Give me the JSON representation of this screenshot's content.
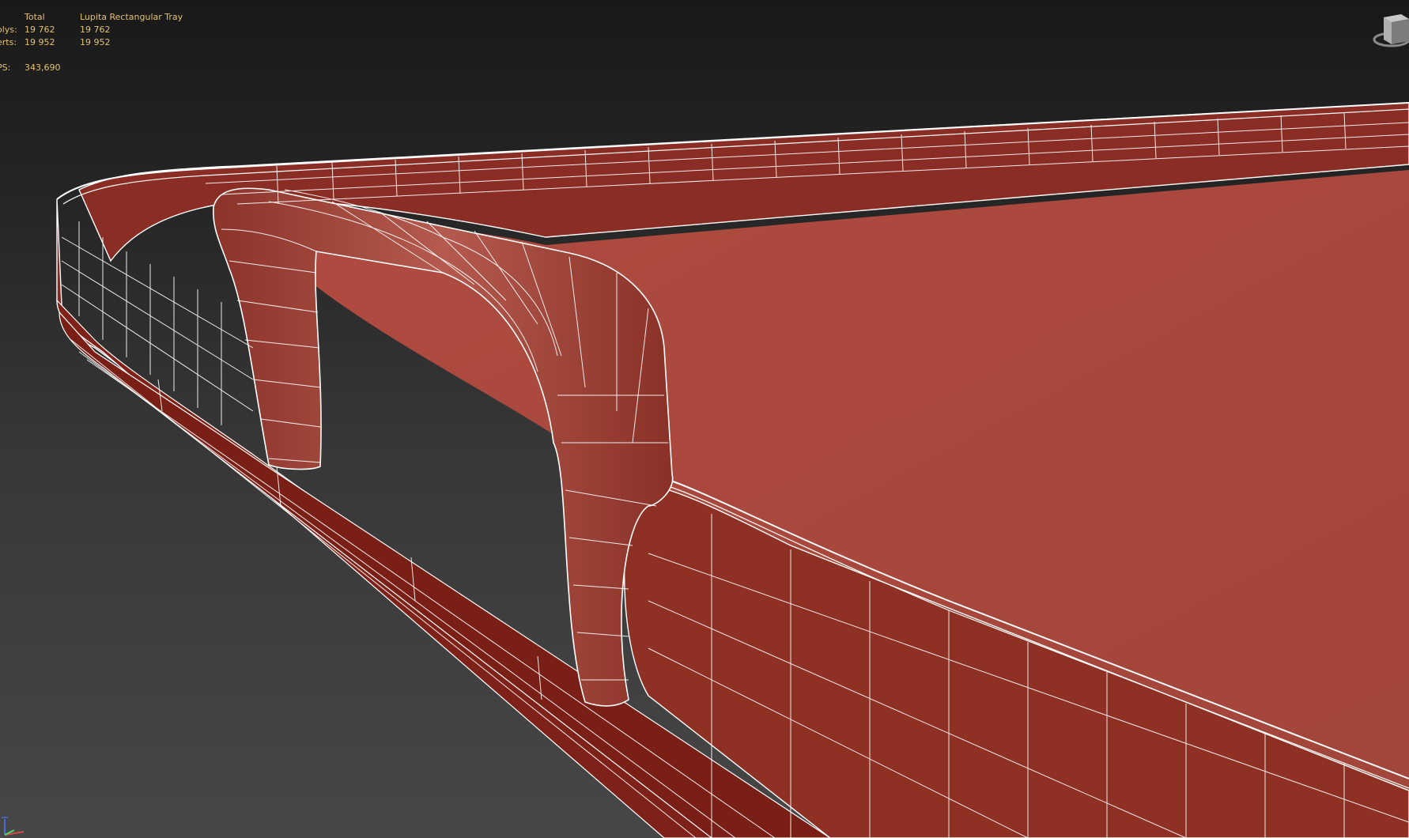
{
  "viewport": {
    "model_name": "Lupita Rectangular Tray",
    "colors": {
      "background_top": "#191919",
      "background_bottom": "#474747",
      "model_red": "#a34a3e",
      "model_dark_red": "#7e2219",
      "wire": "#ffffff",
      "stats_text": "#e3c16f"
    }
  },
  "stats": {
    "header": {
      "label": "",
      "total": "Total",
      "object": "Lupita Rectangular Tray"
    },
    "polys": {
      "label": "olys:",
      "total": "19 762",
      "object": "19 762"
    },
    "verts": {
      "label": "erts:",
      "total": "19 952",
      "object": "19 952"
    },
    "fps": {
      "label": "PS:",
      "value": "343,690"
    }
  },
  "icons": {
    "view_cube": "view-cube-icon",
    "axis_tripod": "axis-tripod-icon"
  }
}
